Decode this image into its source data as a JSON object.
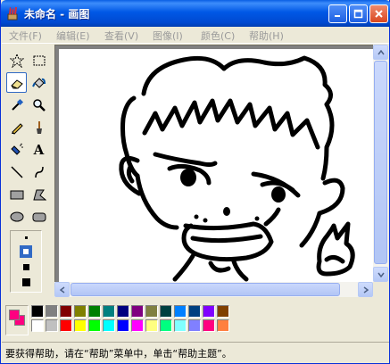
{
  "window": {
    "title": "未命名 - 画图"
  },
  "menu": [
    {
      "label": "文件(F)"
    },
    {
      "label": "编辑(E)"
    },
    {
      "label": "查看(V)"
    },
    {
      "label": "图像(I)"
    },
    {
      "label": "颜色(C)"
    },
    {
      "label": "帮助(H)"
    }
  ],
  "tools": [
    {
      "name": "free-form-select-tool",
      "icon": "star-select-icon"
    },
    {
      "name": "rect-select-tool",
      "icon": "rect-select-icon"
    },
    {
      "name": "eraser-tool",
      "icon": "eraser-icon",
      "selected": true
    },
    {
      "name": "fill-tool",
      "icon": "paint-bucket-icon"
    },
    {
      "name": "pick-color-tool",
      "icon": "eyedropper-icon"
    },
    {
      "name": "magnifier-tool",
      "icon": "magnifier-icon"
    },
    {
      "name": "pencil-tool",
      "icon": "pencil-icon"
    },
    {
      "name": "brush-tool",
      "icon": "brush-icon"
    },
    {
      "name": "airbrush-tool",
      "icon": "airbrush-icon"
    },
    {
      "name": "text-tool",
      "icon": "text-A-icon",
      "glyph": "A"
    },
    {
      "name": "line-tool",
      "icon": "line-icon"
    },
    {
      "name": "curve-tool",
      "icon": "curve-icon"
    },
    {
      "name": "rectangle-tool",
      "icon": "rectangle-icon"
    },
    {
      "name": "polygon-tool",
      "icon": "polygon-icon"
    },
    {
      "name": "ellipse-tool",
      "icon": "ellipse-icon"
    },
    {
      "name": "rounded-rect-tool",
      "icon": "rounded-rect-icon"
    }
  ],
  "palette": {
    "foreground": "#ff0080",
    "background": "#ff0080",
    "colors_top": [
      "#000000",
      "#808080",
      "#800000",
      "#808000",
      "#008000",
      "#008080",
      "#000080",
      "#800080",
      "#808040",
      "#004040",
      "#0080ff",
      "#004080",
      "#8000ff",
      "#804000"
    ],
    "colors_bottom": [
      "#ffffff",
      "#c0c0c0",
      "#ff0000",
      "#ffff00",
      "#00ff00",
      "#00ffff",
      "#0000ff",
      "#ff00ff",
      "#ffff80",
      "#00ff80",
      "#80ffff",
      "#8080ff",
      "#ff0080",
      "#ff8040"
    ]
  },
  "status": {
    "text": "要获得帮助，请在“帮助”菜单中，单击“帮助主题”。"
  }
}
